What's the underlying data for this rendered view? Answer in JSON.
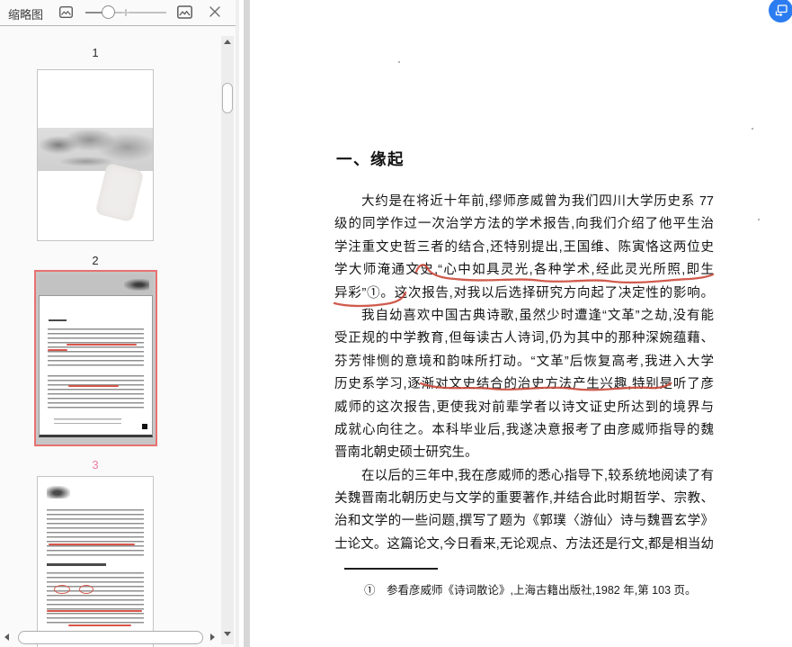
{
  "sidebar": {
    "title": "缩略图",
    "toolbar_icons": [
      "thumbnail-small-icon",
      "thumbnail-large-icon",
      "close-icon"
    ],
    "size_slider": {
      "position_percent": 28
    },
    "page_labels": [
      "1",
      "2",
      "3"
    ],
    "current_page": "3",
    "colors": {
      "selection_border": "#e87170",
      "current_page_number": "#ee7f9f"
    }
  },
  "floating_button": {
    "icon": "screen-translate-icon",
    "color": "#2b7cf0"
  },
  "document": {
    "heading": "一、缘起",
    "lines": [
      "大约是在将近十年前,缪师彦威曾为我们四川大学历史系 77",
      "级的同学作过一次治学方法的学术报告,向我们介绍了他平生治",
      "学注重文史哲三者的结合,还特别提出,王国维、陈寅恪这两位史",
      "学大师淹通文史,“心中如具灵光,各种学术,经此灵光所照,即生",
      "异彩”①。这次报告,对我以后选择研究方向起了决定性的影响。",
      "我自幼喜欢中国古典诗歌,虽然少时遭逢“文革”之劫,没有能",
      "受正规的中学教育,但每读古人诗词,仍为其中的那种深婉蕴藉、",
      "芬芳悱恻的意境和韵味所打动。“文革”后恢复高考,我进入大学",
      "历史系学习,逐渐对文史结合的治史方法产生兴趣,特别是听了彦",
      "威师的这次报告,更使我对前辈学者以诗文证史所达到的境界与",
      "成就心向往之。本科毕业后,我遂决意报考了由彦威师指导的魏",
      "晋南北朝史硕士研究生。",
      "在以后的三年中,我在彦威师的悉心指导下,较系统地阅读了有",
      "关魏晋南北朝历史与文学的重要著作,并结合此时期哲学、宗教、政",
      "治和文学的一些问题,撰写了题为《郭璞〈游仙〉诗与魏晋玄学》的硕",
      "士论文。这篇论文,今日看来,无论观点、方法还是行文,都是相当幼"
    ],
    "footnote": "①　参看彦威师《诗词散论》,上海古籍出版社,1982 年,第 103 页。",
    "annotation_color": "#c94536"
  }
}
